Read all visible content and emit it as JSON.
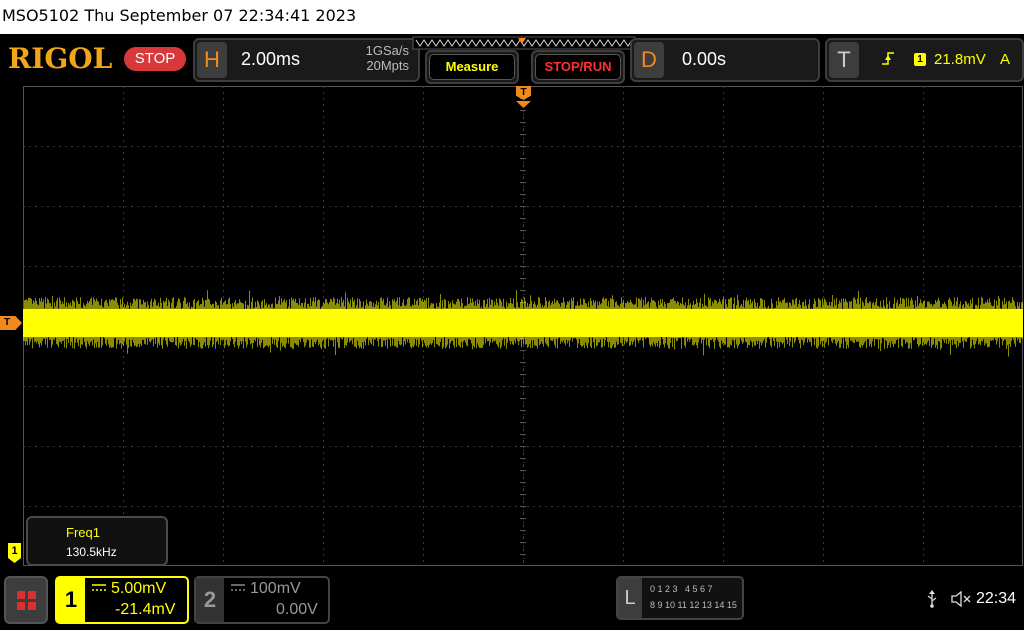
{
  "title_bar": {
    "text": "MSO5102  Thu September 07 22:34:41 2023"
  },
  "brand": {
    "logo": "RIGOL",
    "run_state": "STOP"
  },
  "horizontal": {
    "letter": "H",
    "timebase": "2.00ms",
    "sample_rate": "1GSa/s",
    "memory_depth": "20Mpts"
  },
  "buttons": {
    "measure": "Measure",
    "stop_run": "STOP/RUN"
  },
  "delay": {
    "letter": "D",
    "value": "0.00s"
  },
  "trigger": {
    "letter": "T",
    "source_badge": "1",
    "level": "21.8mV",
    "mode": "A"
  },
  "markers": {
    "trigger_pos": "T",
    "trigger_level": "T",
    "channel1_ground": "1"
  },
  "measurement": {
    "label": "Freq1",
    "value": "130.5kHz"
  },
  "channel1": {
    "number": "1",
    "scale": "5.00mV",
    "offset": "-21.4mV"
  },
  "channel2": {
    "number": "2",
    "scale": "100mV",
    "offset": "0.00V"
  },
  "logic": {
    "letter": "L",
    "row1": "0 1 2 3   4 5 6 7",
    "row2": "8 9 10 11 12 13 14 15"
  },
  "status": {
    "clock": "22:34",
    "icons": [
      "usb-icon",
      "speaker-muted-icon"
    ]
  },
  "colors": {
    "channel1": "#ffff00",
    "accent_orange": "#f08a1c",
    "stop_red": "#d9383a",
    "panel_gray": "#3d3d3d"
  },
  "waveform": {
    "channel": "1",
    "trace": "noise band around trigger level"
  }
}
